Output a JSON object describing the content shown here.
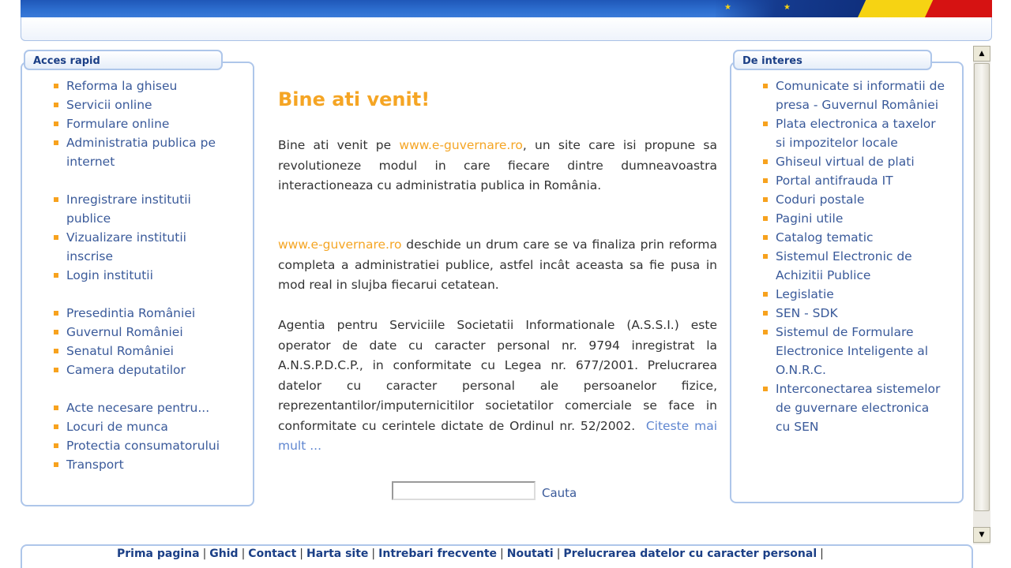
{
  "left_panel": {
    "title": "Acces rapid",
    "items": [
      {
        "label": "Reforma la ghiseu",
        "gap": false
      },
      {
        "label": "Servicii online",
        "gap": false
      },
      {
        "label": "Formulare online",
        "gap": false
      },
      {
        "label": "Administratia publica pe internet",
        "gap": false
      },
      {
        "label": "Inregistrare institutii publice",
        "gap": true
      },
      {
        "label": "Vizualizare institutii inscrise",
        "gap": false
      },
      {
        "label": "Login institutii",
        "gap": false
      },
      {
        "label": "Presedintia României",
        "gap": true
      },
      {
        "label": "Guvernul României",
        "gap": false
      },
      {
        "label": "Senatul României",
        "gap": false
      },
      {
        "label": "Camera deputatilor",
        "gap": false
      },
      {
        "label": "Acte necesare pentru...",
        "gap": true
      },
      {
        "label": "Locuri de munca",
        "gap": false
      },
      {
        "label": "Protectia consumatorului",
        "gap": false
      },
      {
        "label": "Transport",
        "gap": false
      }
    ]
  },
  "right_panel": {
    "title": "De interes",
    "items": [
      "Comunicate si informatii de presa - Guvernul României",
      "Plata electronica a taxelor si impozitelor locale",
      "Ghiseul virtual de plati",
      "Portal antifrauda IT",
      "Coduri postale",
      "Pagini utile",
      "Catalog tematic",
      "Sistemul Electronic de Achizitii Publice",
      "Legislatie",
      "SEN - SDK",
      "Sistemul de Formulare Electronice Inteligente al O.N.R.C.",
      "Interconectarea sistemelor de guvernare electronica cu SEN"
    ]
  },
  "main": {
    "welcome_title": "Bine ati venit!",
    "p1_before": "Bine ati venit pe ",
    "p1_link": "www.e-guvernare.ro",
    "p1_after": ", un site care isi propune sa revolutioneze modul in care fiecare dintre dumneavoastra interactioneaza cu administratia publica in România.",
    "p2_link": "www.e-guvernare.ro",
    "p2_after": " deschide un drum care se va finaliza prin reforma completa a administratiei publice, astfel incât aceasta sa fie pusa in mod real in slujba fiecarui cetatean.",
    "p3_text": "Agentia pentru Serviciile Societatii Informationale (A.S.S.I.) este operator de date cu caracter personal nr. 9794 inregistrat la A.N.S.P.D.C.P., in conformitate cu Legea nr. 677/2001. Prelucrarea datelor cu caracter personal ale persoanelor fizice, reprezentantilor/imputernicitilor societatilor comerciale se face in conformitate cu cerintele dictate de Ordinul nr. 52/2002.",
    "read_more": "Citeste mai mult ...",
    "search_value": "",
    "search_button": "Cauta"
  },
  "footer": {
    "links": [
      "Prima pagina",
      "Ghid",
      "Contact",
      "Harta site",
      "Intrebari frecvente",
      "Noutati",
      "Prelucrarea datelor cu caracter personal"
    ]
  },
  "colors": {
    "accent_orange": "#f5a524",
    "link_blue": "#3a5a9a",
    "panel_border": "#aec6ea",
    "banner_blue": "#2e6fd0"
  }
}
